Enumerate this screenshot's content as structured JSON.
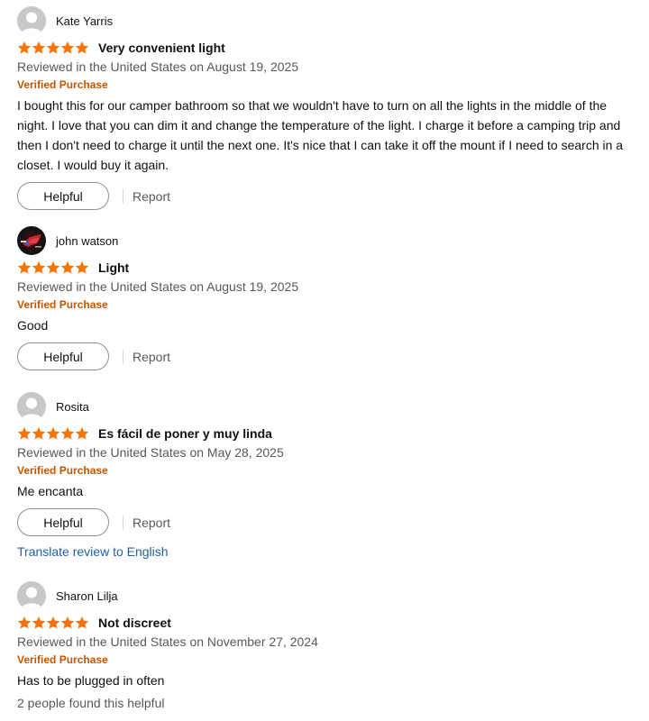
{
  "colors": {
    "star": "#F9730A",
    "verified": "#C45500",
    "link": "#2162A1",
    "muted": "#565959"
  },
  "reviews": [
    {
      "profile_name": "Kate Yarris",
      "avatar": "default-avatar-icon",
      "rating": 5,
      "title": "Very convenient light",
      "date": "Reviewed in the United States on August 19, 2025",
      "verified": "Verified Purchase",
      "body": "I bought this for our camper bathroom so that we wouldn't have to turn on all the lights in the middle of the night. I love that you can dim it and change the temperature of the light. I charge it before a camping trip and then I don't need to charge it until the next one. It's nice that I can take it off the mount if I need to search in a closet. I would buy it again.",
      "helpful_label": "Helpful",
      "report_label": "Report"
    },
    {
      "profile_name": "john watson",
      "avatar": "photo-avatar-icon",
      "rating": 5,
      "title": "Light",
      "date": "Reviewed in the United States on August 19, 2025",
      "verified": "Verified Purchase",
      "body": "Good",
      "helpful_label": "Helpful",
      "report_label": "Report"
    },
    {
      "profile_name": "Rosita",
      "avatar": "default-avatar-icon",
      "rating": 5,
      "title": "Es fácil de poner y muy linda",
      "date": "Reviewed in the United States on May 28, 2025",
      "verified": "Verified Purchase",
      "body": "Me encanta",
      "helpful_label": "Helpful",
      "report_label": "Report",
      "translate_label": "Translate review to English"
    },
    {
      "profile_name": "Sharon Lilja",
      "avatar": "default-avatar-icon",
      "rating": 5,
      "title": "Not discreet",
      "date": "Reviewed in the United States on November 27, 2024",
      "verified": "Verified Purchase",
      "body": "Has to be plugged in often",
      "helpful_count_text": "2 people found this helpful"
    }
  ]
}
